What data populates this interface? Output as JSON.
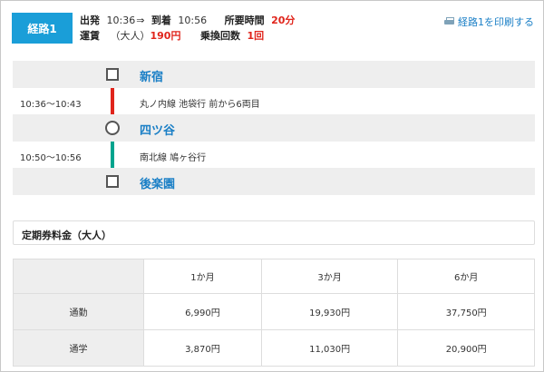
{
  "summary": {
    "route_label": "経路1",
    "depart_label": "出発",
    "depart_time": "10:36",
    "arrow": "⇒",
    "arrive_label": "到着",
    "arrive_time": "10:56",
    "duration_label": "所要時間",
    "duration": "20分",
    "fare_label": "運賃",
    "fare_type": "（大人）",
    "fare": "190円",
    "transfers_label": "乗換回数",
    "transfers": "1回",
    "print_label": "経路1を印刷する"
  },
  "route": {
    "stations": [
      "新宿",
      "四ツ谷",
      "後楽園"
    ],
    "segments": [
      {
        "time": "10:36～10:43",
        "line": "丸ノ内線 池袋行 前から6両目",
        "color": "#e0241b"
      },
      {
        "time": "10:50～10:56",
        "line": "南北線 鳩ヶ谷行",
        "color": "#00a48e"
      }
    ]
  },
  "pass": {
    "title": "定期券料金（大人）",
    "columns": [
      "1か月",
      "3か月",
      "6か月"
    ],
    "rows": [
      {
        "label": "通勤",
        "values": [
          "6,990円",
          "19,930円",
          "37,750円"
        ]
      },
      {
        "label": "通学",
        "values": [
          "3,870円",
          "11,030円",
          "20,900円"
        ]
      }
    ]
  }
}
